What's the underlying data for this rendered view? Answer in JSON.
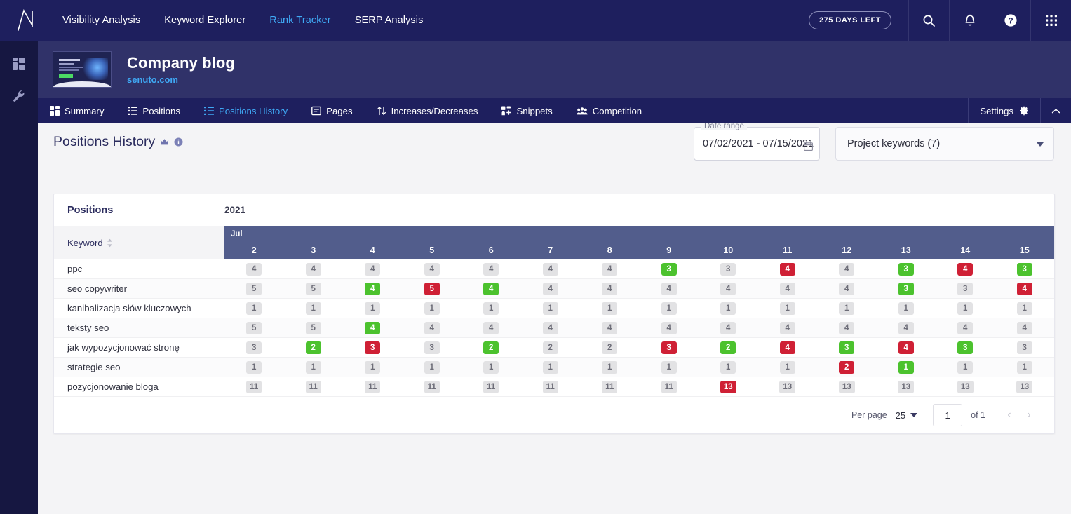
{
  "topnav": {
    "logo": "senuto-logo",
    "links": [
      {
        "label": "Visibility Analysis",
        "active": false
      },
      {
        "label": "Keyword Explorer",
        "active": false
      },
      {
        "label": "Rank Tracker",
        "active": true
      },
      {
        "label": "SERP Analysis",
        "active": false
      }
    ],
    "days_badge": "275 DAYS LEFT",
    "icons": [
      "search-icon",
      "bell-icon",
      "help-icon",
      "apps-grid-icon"
    ]
  },
  "rail": {
    "items": [
      {
        "icon": "dashboard-grid-icon"
      },
      {
        "icon": "wrench-icon"
      }
    ]
  },
  "project": {
    "thumbnail": "site-preview-thumbnail",
    "title": "Company blog",
    "domain": "senuto.com"
  },
  "tabs": {
    "items": [
      {
        "label": "Summary",
        "icon": "grid-icon",
        "active": false
      },
      {
        "label": "Positions",
        "icon": "list-icon",
        "active": false
      },
      {
        "label": "Positions History",
        "icon": "list-icon",
        "active": true
      },
      {
        "label": "Pages",
        "icon": "page-icon",
        "active": false
      },
      {
        "label": "Increases/Decreases",
        "icon": "arrows-updown-icon",
        "active": false
      },
      {
        "label": "Snippets",
        "icon": "snippets-icon",
        "active": false
      },
      {
        "label": "Competition",
        "icon": "people-icon",
        "active": false
      }
    ],
    "settings_label": "Settings",
    "settings_icon": "gear-icon",
    "collapse_icon": "chevron-up-icon"
  },
  "page": {
    "title": "Positions History",
    "title_badge_icon": "crown-icon",
    "info_icon": "info-icon"
  },
  "date_range": {
    "legend": "Date range",
    "value": "07/02/2021 - 07/15/2021",
    "icon": "calendar-icon"
  },
  "keyword_select": {
    "value": "Project keywords (7)",
    "caret_icon": "chevron-down-icon"
  },
  "table": {
    "positions_label": "Positions",
    "year_label": "2021",
    "keyword_col_label": "Keyword",
    "sort_icon": "sort-icon",
    "month_label": "Jul",
    "days": [
      "2",
      "3",
      "4",
      "5",
      "6",
      "7",
      "8",
      "9",
      "10",
      "11",
      "12",
      "13",
      "14",
      "15"
    ],
    "rows": [
      {
        "keyword": "ppc",
        "cells": [
          {
            "v": "4",
            "s": "neutral"
          },
          {
            "v": "4",
            "s": "neutral"
          },
          {
            "v": "4",
            "s": "neutral"
          },
          {
            "v": "4",
            "s": "neutral"
          },
          {
            "v": "4",
            "s": "neutral"
          },
          {
            "v": "4",
            "s": "neutral"
          },
          {
            "v": "4",
            "s": "neutral"
          },
          {
            "v": "3",
            "s": "up"
          },
          {
            "v": "3",
            "s": "neutral"
          },
          {
            "v": "4",
            "s": "down"
          },
          {
            "v": "4",
            "s": "neutral"
          },
          {
            "v": "3",
            "s": "up"
          },
          {
            "v": "4",
            "s": "down"
          },
          {
            "v": "3",
            "s": "up"
          }
        ]
      },
      {
        "keyword": "seo copywriter",
        "cells": [
          {
            "v": "5",
            "s": "neutral"
          },
          {
            "v": "5",
            "s": "neutral"
          },
          {
            "v": "4",
            "s": "up"
          },
          {
            "v": "5",
            "s": "down"
          },
          {
            "v": "4",
            "s": "up"
          },
          {
            "v": "4",
            "s": "neutral"
          },
          {
            "v": "4",
            "s": "neutral"
          },
          {
            "v": "4",
            "s": "neutral"
          },
          {
            "v": "4",
            "s": "neutral"
          },
          {
            "v": "4",
            "s": "neutral"
          },
          {
            "v": "4",
            "s": "neutral"
          },
          {
            "v": "3",
            "s": "up"
          },
          {
            "v": "3",
            "s": "neutral"
          },
          {
            "v": "4",
            "s": "down"
          }
        ]
      },
      {
        "keyword": "kanibalizacja słów kluczowych",
        "cells": [
          {
            "v": "1",
            "s": "neutral"
          },
          {
            "v": "1",
            "s": "neutral"
          },
          {
            "v": "1",
            "s": "neutral"
          },
          {
            "v": "1",
            "s": "neutral"
          },
          {
            "v": "1",
            "s": "neutral"
          },
          {
            "v": "1",
            "s": "neutral"
          },
          {
            "v": "1",
            "s": "neutral"
          },
          {
            "v": "1",
            "s": "neutral"
          },
          {
            "v": "1",
            "s": "neutral"
          },
          {
            "v": "1",
            "s": "neutral"
          },
          {
            "v": "1",
            "s": "neutral"
          },
          {
            "v": "1",
            "s": "neutral"
          },
          {
            "v": "1",
            "s": "neutral"
          },
          {
            "v": "1",
            "s": "neutral"
          }
        ]
      },
      {
        "keyword": "teksty seo",
        "cells": [
          {
            "v": "5",
            "s": "neutral"
          },
          {
            "v": "5",
            "s": "neutral"
          },
          {
            "v": "4",
            "s": "up"
          },
          {
            "v": "4",
            "s": "neutral"
          },
          {
            "v": "4",
            "s": "neutral"
          },
          {
            "v": "4",
            "s": "neutral"
          },
          {
            "v": "4",
            "s": "neutral"
          },
          {
            "v": "4",
            "s": "neutral"
          },
          {
            "v": "4",
            "s": "neutral"
          },
          {
            "v": "4",
            "s": "neutral"
          },
          {
            "v": "4",
            "s": "neutral"
          },
          {
            "v": "4",
            "s": "neutral"
          },
          {
            "v": "4",
            "s": "neutral"
          },
          {
            "v": "4",
            "s": "neutral"
          }
        ]
      },
      {
        "keyword": "jak wypozycjonować stronę",
        "cells": [
          {
            "v": "3",
            "s": "neutral"
          },
          {
            "v": "2",
            "s": "up"
          },
          {
            "v": "3",
            "s": "down"
          },
          {
            "v": "3",
            "s": "neutral"
          },
          {
            "v": "2",
            "s": "up"
          },
          {
            "v": "2",
            "s": "neutral"
          },
          {
            "v": "2",
            "s": "neutral"
          },
          {
            "v": "3",
            "s": "down"
          },
          {
            "v": "2",
            "s": "up"
          },
          {
            "v": "4",
            "s": "down"
          },
          {
            "v": "3",
            "s": "up"
          },
          {
            "v": "4",
            "s": "down"
          },
          {
            "v": "3",
            "s": "up"
          },
          {
            "v": "3",
            "s": "neutral"
          }
        ]
      },
      {
        "keyword": "strategie seo",
        "cells": [
          {
            "v": "1",
            "s": "neutral"
          },
          {
            "v": "1",
            "s": "neutral"
          },
          {
            "v": "1",
            "s": "neutral"
          },
          {
            "v": "1",
            "s": "neutral"
          },
          {
            "v": "1",
            "s": "neutral"
          },
          {
            "v": "1",
            "s": "neutral"
          },
          {
            "v": "1",
            "s": "neutral"
          },
          {
            "v": "1",
            "s": "neutral"
          },
          {
            "v": "1",
            "s": "neutral"
          },
          {
            "v": "1",
            "s": "neutral"
          },
          {
            "v": "2",
            "s": "down"
          },
          {
            "v": "1",
            "s": "up"
          },
          {
            "v": "1",
            "s": "neutral"
          },
          {
            "v": "1",
            "s": "neutral"
          }
        ]
      },
      {
        "keyword": "pozycjonowanie bloga",
        "cells": [
          {
            "v": "11",
            "s": "neutral"
          },
          {
            "v": "11",
            "s": "neutral"
          },
          {
            "v": "11",
            "s": "neutral"
          },
          {
            "v": "11",
            "s": "neutral"
          },
          {
            "v": "11",
            "s": "neutral"
          },
          {
            "v": "11",
            "s": "neutral"
          },
          {
            "v": "11",
            "s": "neutral"
          },
          {
            "v": "11",
            "s": "neutral"
          },
          {
            "v": "13",
            "s": "down"
          },
          {
            "v": "13",
            "s": "neutral"
          },
          {
            "v": "13",
            "s": "neutral"
          },
          {
            "v": "13",
            "s": "neutral"
          },
          {
            "v": "13",
            "s": "neutral"
          },
          {
            "v": "13",
            "s": "neutral"
          }
        ]
      }
    ]
  },
  "pagination": {
    "per_page_label": "Per page",
    "per_page_value": "25",
    "page_value": "1",
    "of_label": "of 1",
    "prev_icon": "chevron-left-icon",
    "next_icon": "chevron-right-icon"
  },
  "colors": {
    "navy": "#1e1f5e",
    "rail": "#161741",
    "project_header": "#303269",
    "accent_blue": "#3fa9f5",
    "table_header": "#525d8c",
    "up_green": "#4cc22e",
    "down_red": "#cf2035",
    "neutral_gray": "#e2e2e4"
  }
}
